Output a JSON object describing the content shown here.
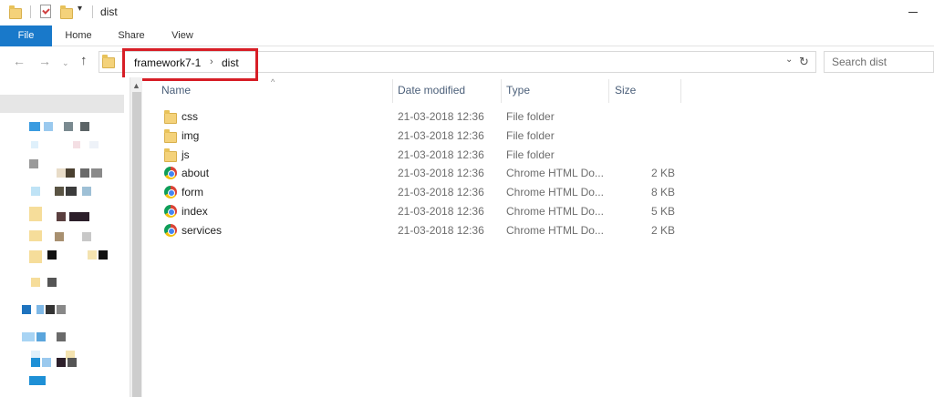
{
  "window": {
    "title": "dist",
    "qa_dropdown": "▾"
  },
  "ribbon": {
    "tabs": [
      "File",
      "Home",
      "Share",
      "View"
    ]
  },
  "address": {
    "breadcrumbs": [
      "framework7-1",
      "dist"
    ],
    "separator": "›",
    "search_placeholder": "Search dist"
  },
  "columns": [
    "Name",
    "Date modified",
    "Type",
    "Size"
  ],
  "files": [
    {
      "name": "css",
      "date": "21-03-2018 12:36",
      "type": "File folder",
      "size": "",
      "icon": "folder-icon"
    },
    {
      "name": "img",
      "date": "21-03-2018 12:36",
      "type": "File folder",
      "size": "",
      "icon": "folder-icon"
    },
    {
      "name": "js",
      "date": "21-03-2018 12:36",
      "type": "File folder",
      "size": "",
      "icon": "folder-icon"
    },
    {
      "name": "about",
      "date": "21-03-2018 12:36",
      "type": "Chrome HTML Do...",
      "size": "2 KB",
      "icon": "chrome-icon"
    },
    {
      "name": "form",
      "date": "21-03-2018 12:36",
      "type": "Chrome HTML Do...",
      "size": "8 KB",
      "icon": "chrome-icon"
    },
    {
      "name": "index",
      "date": "21-03-2018 12:36",
      "type": "Chrome HTML Do...",
      "size": "5 KB",
      "icon": "chrome-icon"
    },
    {
      "name": "services",
      "date": "21-03-2018 12:36",
      "type": "Chrome HTML Do...",
      "size": "2 KB",
      "icon": "chrome-icon"
    }
  ],
  "colors": {
    "file_tab": "#1979ca",
    "highlight": "#d71e26",
    "header_text": "#4c607a"
  }
}
